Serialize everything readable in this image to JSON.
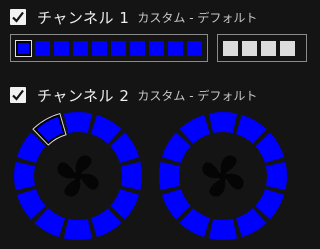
{
  "channel1": {
    "name": "チャンネル 1",
    "subtitle": "カスタム - デフォルト",
    "checked": true,
    "strip1": {
      "leds": 10,
      "selected_index": 0
    },
    "strip2": {
      "leds": 4
    }
  },
  "channel2": {
    "name": "チャンネル 2",
    "subtitle": "カスタム - デフォルト",
    "checked": true,
    "fan1": {
      "segments": 12,
      "selected_index": 0
    },
    "fan2": {
      "segments": 12
    }
  },
  "colors": {
    "led_color": "#0000ff",
    "inactive_led": "#dcdcdc",
    "background": "#141414"
  },
  "icons": {
    "checkbox": "check-icon",
    "fan": "fan-icon"
  }
}
